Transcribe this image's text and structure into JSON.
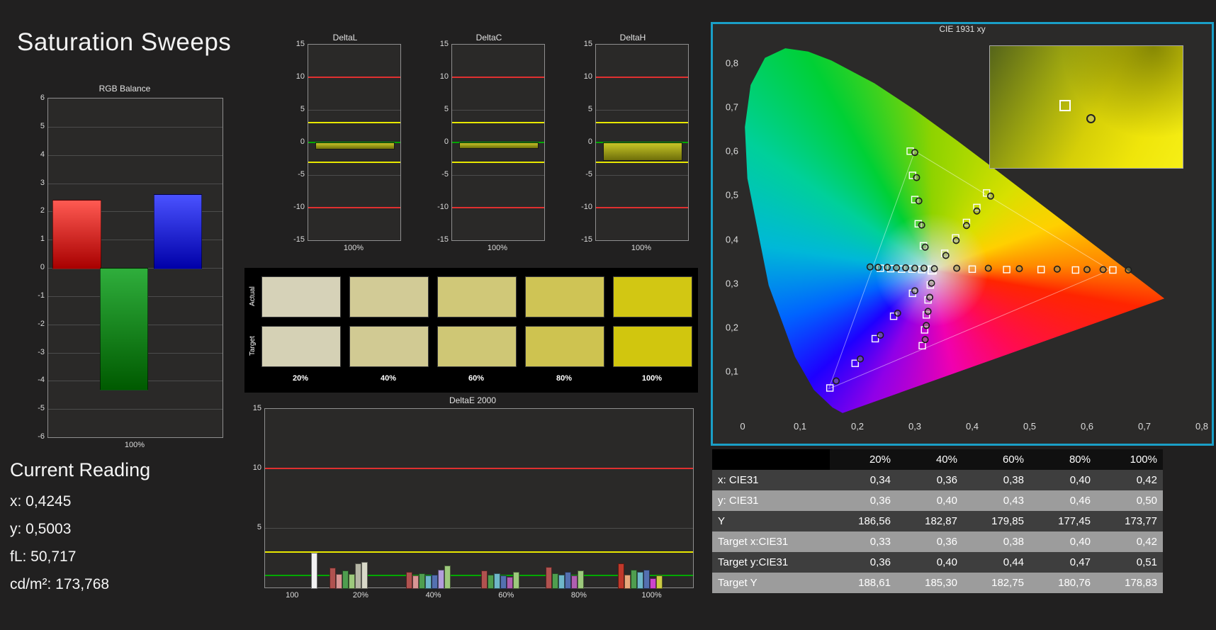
{
  "page": {
    "title": "Saturation Sweeps"
  },
  "current_reading": {
    "heading": "Current Reading",
    "x": "x: 0,4245",
    "y": "y: 0,5003",
    "fl": "fL: 50,717",
    "cdm2": "cd/m²: 173,768"
  },
  "swatch_panel": {
    "row_labels": [
      "Actual",
      "Target"
    ],
    "col_labels": [
      "20%",
      "40%",
      "60%",
      "80%",
      "100%"
    ],
    "actual_colors": [
      "#d6d2b8",
      "#d2cb96",
      "#d0c878",
      "#cfc455",
      "#d2c713"
    ],
    "target_colors": [
      "#d5d1b5",
      "#d1ca93",
      "#cfc775",
      "#cec350",
      "#d1c60e"
    ]
  },
  "chart_data": [
    {
      "id": "rgb_balance",
      "type": "bar",
      "title": "RGB Balance",
      "categories": [
        "Red",
        "Green",
        "Blue"
      ],
      "values": [
        2.4,
        -4.3,
        2.6
      ],
      "bar_colors_top": [
        "#ff5a52",
        "#2fae3c",
        "#4a52ff"
      ],
      "bar_colors_bottom": [
        "#a80000",
        "#005a00",
        "#0000a8"
      ],
      "ylim": [
        -6,
        6
      ],
      "ytick_step": 1,
      "xlabel": "100%"
    },
    {
      "id": "deltaL",
      "type": "bar",
      "title": "DeltaL",
      "categories": [
        "100%"
      ],
      "values": [
        -0.9
      ],
      "ylim": [
        -15,
        15
      ],
      "ytick_step": 5,
      "xlabel": "100%",
      "ref_lines": [
        {
          "y": 10,
          "color": "#e03030"
        },
        {
          "y": -10,
          "color": "#e03030"
        },
        {
          "y": 3,
          "color": "#e8e800"
        },
        {
          "y": -3,
          "color": "#e8e800"
        },
        {
          "y": 0,
          "color": "#00a800"
        }
      ]
    },
    {
      "id": "deltaC",
      "type": "bar",
      "title": "DeltaC",
      "categories": [
        "100%"
      ],
      "values": [
        -0.8
      ],
      "ylim": [
        -15,
        15
      ],
      "ytick_step": 5,
      "xlabel": "100%",
      "ref_lines": [
        {
          "y": 10,
          "color": "#e03030"
        },
        {
          "y": -10,
          "color": "#e03030"
        },
        {
          "y": 3,
          "color": "#e8e800"
        },
        {
          "y": -3,
          "color": "#e8e800"
        },
        {
          "y": 0,
          "color": "#00a800"
        }
      ]
    },
    {
      "id": "deltaH",
      "type": "bar",
      "title": "DeltaH",
      "categories": [
        "100%"
      ],
      "values": [
        -2.6
      ],
      "ylim": [
        -15,
        15
      ],
      "ytick_step": 5,
      "xlabel": "100%",
      "ref_lines": [
        {
          "y": 10,
          "color": "#e03030"
        },
        {
          "y": -10,
          "color": "#e03030"
        },
        {
          "y": 3,
          "color": "#e8e800"
        },
        {
          "y": -3,
          "color": "#e8e800"
        },
        {
          "y": 0,
          "color": "#00a800"
        }
      ]
    },
    {
      "id": "deltaE2000",
      "type": "bar",
      "title": "DeltaE 2000",
      "ylim": [
        0,
        15
      ],
      "ytick_values": [
        5,
        10,
        15
      ],
      "ref_lines": [
        {
          "y": 10,
          "color": "#e03030"
        },
        {
          "y": 3,
          "color": "#e8e800"
        },
        {
          "y": 1,
          "color": "#00a800"
        }
      ],
      "xtick_labels": [
        {
          "label": "100",
          "frac": 0.065
        },
        {
          "label": "20%",
          "frac": 0.225
        },
        {
          "label": "40%",
          "frac": 0.395
        },
        {
          "label": "60%",
          "frac": 0.565
        },
        {
          "label": "80%",
          "frac": 0.735
        },
        {
          "label": "100%",
          "frac": 0.905
        }
      ],
      "groups": [
        {
          "frac": 0.108,
          "bars": [
            {
              "c": "#f2f2f2",
              "v": 2.9
            }
          ]
        },
        {
          "frac": 0.15,
          "bars": [
            {
              "c": "#b0524f",
              "v": 1.65
            },
            {
              "c": "#d89694",
              "v": 1.15
            },
            {
              "c": "#4f9e4f",
              "v": 1.4
            },
            {
              "c": "#9dc97c",
              "v": 1.15
            },
            {
              "c": "#b5b5a5",
              "v": 2.0
            },
            {
              "c": "#d9d9c9",
              "v": 2.15
            }
          ]
        },
        {
          "frac": 0.33,
          "bars": [
            {
              "c": "#b0524f",
              "v": 1.3
            },
            {
              "c": "#d89694",
              "v": 1.0
            },
            {
              "c": "#4f9e4f",
              "v": 1.2
            },
            {
              "c": "#6fb7c9",
              "v": 1.0
            },
            {
              "c": "#5470b0",
              "v": 1.1
            },
            {
              "c": "#b39ddb",
              "v": 1.5
            },
            {
              "c": "#9dc97c",
              "v": 1.85
            }
          ]
        },
        {
          "frac": 0.505,
          "bars": [
            {
              "c": "#b0524f",
              "v": 1.4
            },
            {
              "c": "#4f9e4f",
              "v": 1.1
            },
            {
              "c": "#6fb7c9",
              "v": 1.2
            },
            {
              "c": "#5470b0",
              "v": 1.0
            },
            {
              "c": "#b05fb0",
              "v": 0.9
            },
            {
              "c": "#9dc97c",
              "v": 1.3
            }
          ]
        },
        {
          "frac": 0.655,
          "bars": [
            {
              "c": "#b0524f",
              "v": 1.7
            },
            {
              "c": "#4f9e4f",
              "v": 1.2
            },
            {
              "c": "#6fb7c9",
              "v": 1.1
            },
            {
              "c": "#5470b0",
              "v": 1.3
            },
            {
              "c": "#b05fb0",
              "v": 1.0
            },
            {
              "c": "#9dc97c",
              "v": 1.4
            }
          ]
        },
        {
          "frac": 0.825,
          "bars": [
            {
              "c": "#c0392b",
              "v": 2.0
            },
            {
              "c": "#e8a87c",
              "v": 1.1
            },
            {
              "c": "#4f9e4f",
              "v": 1.5
            },
            {
              "c": "#6fb7c9",
              "v": 1.3
            },
            {
              "c": "#5470b0",
              "v": 1.5
            },
            {
              "c": "#cc44cc",
              "v": 0.8
            },
            {
              "c": "#cccc44",
              "v": 1.0
            }
          ]
        }
      ]
    },
    {
      "id": "cie1931",
      "type": "scatter",
      "title": "CIE 1931 xy",
      "xlim": [
        0,
        0.8
      ],
      "ylim": [
        0,
        0.85
      ],
      "xtick_labels": [
        "0",
        "0,1",
        "0,2",
        "0,3",
        "0,4",
        "0,5",
        "0,6",
        "0,7",
        "0,8"
      ],
      "ytick_labels": [
        "0,1",
        "0,2",
        "0,3",
        "0,4",
        "0,5",
        "0,6",
        "0,7",
        "0,8"
      ],
      "gamut_triangle": [
        [
          0.64,
          0.33
        ],
        [
          0.3,
          0.6
        ],
        [
          0.15,
          0.06
        ]
      ],
      "spectral_locus": [
        [
          0.1741,
          0.005
        ],
        [
          0.1566,
          0.0177
        ],
        [
          0.1241,
          0.0578
        ],
        [
          0.0913,
          0.1327
        ],
        [
          0.0454,
          0.295
        ],
        [
          0.0082,
          0.5384
        ],
        [
          0.0039,
          0.6548
        ],
        [
          0.0139,
          0.7502
        ],
        [
          0.0389,
          0.812
        ],
        [
          0.0743,
          0.8338
        ],
        [
          0.1142,
          0.8262
        ],
        [
          0.1547,
          0.8059
        ],
        [
          0.2296,
          0.7543
        ],
        [
          0.3016,
          0.6923
        ],
        [
          0.3731,
          0.6245
        ],
        [
          0.4441,
          0.5547
        ],
        [
          0.5125,
          0.4866
        ],
        [
          0.5752,
          0.4242
        ],
        [
          0.627,
          0.3725
        ],
        [
          0.6658,
          0.334
        ],
        [
          0.6915,
          0.3083
        ],
        [
          0.7079,
          0.292
        ],
        [
          0.7347,
          0.2653
        ]
      ],
      "targets": [
        [
          0.33,
          0.33
        ],
        [
          0.4,
          0.332
        ],
        [
          0.46,
          0.331
        ],
        [
          0.52,
          0.331
        ],
        [
          0.58,
          0.33
        ],
        [
          0.645,
          0.33
        ],
        [
          0.315,
          0.385
        ],
        [
          0.306,
          0.435
        ],
        [
          0.3,
          0.49
        ],
        [
          0.296,
          0.545
        ],
        [
          0.292,
          0.6
        ],
        [
          0.296,
          0.277
        ],
        [
          0.263,
          0.225
        ],
        [
          0.231,
          0.174
        ],
        [
          0.196,
          0.118
        ],
        [
          0.152,
          0.062
        ],
        [
          0.352,
          0.368
        ],
        [
          0.371,
          0.403
        ],
        [
          0.39,
          0.438
        ],
        [
          0.408,
          0.472
        ],
        [
          0.425,
          0.505
        ],
        [
          0.327,
          0.296
        ],
        [
          0.323,
          0.262
        ],
        [
          0.32,
          0.228
        ],
        [
          0.317,
          0.194
        ],
        [
          0.313,
          0.158
        ],
        [
          0.312,
          0.331
        ],
        [
          0.295,
          0.332
        ],
        [
          0.277,
          0.332
        ],
        [
          0.258,
          0.333
        ],
        [
          0.24,
          0.334
        ]
      ],
      "measurements": [
        [
          0.334,
          0.333
        ],
        [
          0.373,
          0.334
        ],
        [
          0.428,
          0.334
        ],
        [
          0.482,
          0.333
        ],
        [
          0.548,
          0.332
        ],
        [
          0.6,
          0.331
        ],
        [
          0.628,
          0.331
        ],
        [
          0.672,
          0.33
        ],
        [
          0.318,
          0.382
        ],
        [
          0.312,
          0.432
        ],
        [
          0.307,
          0.487
        ],
        [
          0.303,
          0.54
        ],
        [
          0.3,
          0.597
        ],
        [
          0.3,
          0.283
        ],
        [
          0.27,
          0.232
        ],
        [
          0.24,
          0.182
        ],
        [
          0.205,
          0.128
        ],
        [
          0.163,
          0.078
        ],
        [
          0.354,
          0.363
        ],
        [
          0.372,
          0.397
        ],
        [
          0.39,
          0.431
        ],
        [
          0.408,
          0.464
        ],
        [
          0.432,
          0.498
        ],
        [
          0.329,
          0.3
        ],
        [
          0.326,
          0.268
        ],
        [
          0.323,
          0.236
        ],
        [
          0.32,
          0.204
        ],
        [
          0.318,
          0.172
        ],
        [
          0.316,
          0.334
        ],
        [
          0.3,
          0.334
        ],
        [
          0.284,
          0.335
        ],
        [
          0.268,
          0.335
        ],
        [
          0.252,
          0.336
        ],
        [
          0.236,
          0.336
        ],
        [
          0.222,
          0.337
        ]
      ]
    }
  ],
  "table": {
    "headers": [
      "",
      "20%",
      "40%",
      "60%",
      "80%",
      "100%"
    ],
    "rows": [
      {
        "label": "x: CIE31",
        "shade": "dark",
        "values": [
          "0,34",
          "0,36",
          "0,38",
          "0,40",
          "0,42"
        ]
      },
      {
        "label": "y: CIE31",
        "shade": "light",
        "values": [
          "0,36",
          "0,40",
          "0,43",
          "0,46",
          "0,50"
        ]
      },
      {
        "label": "Y",
        "shade": "dark",
        "values": [
          "186,56",
          "182,87",
          "179,85",
          "177,45",
          "173,77"
        ]
      },
      {
        "label": "Target x:CIE31",
        "shade": "light",
        "values": [
          "0,33",
          "0,36",
          "0,38",
          "0,40",
          "0,42"
        ]
      },
      {
        "label": "Target y:CIE31",
        "shade": "dark",
        "values": [
          "0,36",
          "0,40",
          "0,44",
          "0,47",
          "0,51"
        ]
      },
      {
        "label": "Target Y",
        "shade": "light",
        "values": [
          "188,61",
          "185,30",
          "182,75",
          "180,76",
          "178,83"
        ]
      }
    ]
  }
}
